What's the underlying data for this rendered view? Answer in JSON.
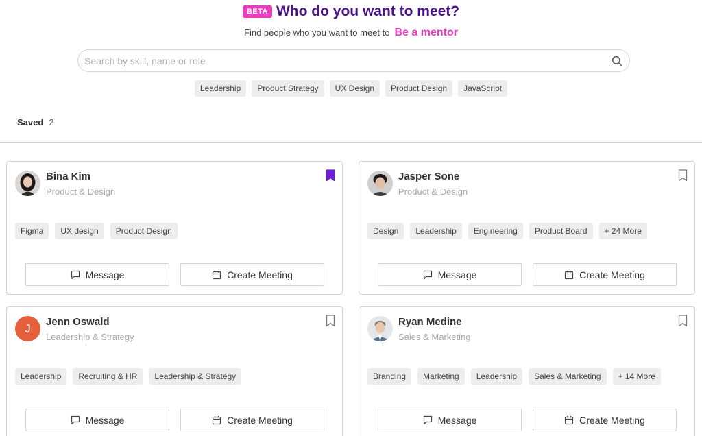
{
  "header": {
    "badge": "BETA",
    "title": "Who do you want to meet?",
    "subtitle": "Find people who you want to meet to",
    "mentor_link": "Be a mentor"
  },
  "search": {
    "placeholder": "Search by skill, name or role",
    "value": ""
  },
  "filter_chips": [
    "Leadership",
    "Product Strategy",
    "UX Design",
    "Product Design",
    "JavaScript"
  ],
  "saved": {
    "label": "Saved",
    "count": "2"
  },
  "actions": {
    "message": "Message",
    "create_meeting": "Create Meeting"
  },
  "people": [
    {
      "name": "Bina Kim",
      "role": "Product & Design",
      "skills": [
        "Figma",
        "UX design",
        "Product Design"
      ],
      "bookmarked": true,
      "avatar_initial": ""
    },
    {
      "name": "Jasper Sone",
      "role": "Product & Design",
      "skills": [
        "Design",
        "Leadership",
        "Engineering",
        "Product Board",
        "+ 24 More"
      ],
      "bookmarked": false,
      "avatar_initial": ""
    },
    {
      "name": "Jenn Oswald",
      "role": "Leadership & Strategy",
      "skills": [
        "Leadership",
        "Recruiting & HR",
        "Leadership & Strategy"
      ],
      "bookmarked": false,
      "avatar_initial": "J"
    },
    {
      "name": "Ryan Medine",
      "role": "Sales & Marketing",
      "skills": [
        "Branding",
        "Marketing",
        "Leadership",
        "Sales & Marketing",
        "+ 14 More"
      ],
      "bookmarked": false,
      "avatar_initial": ""
    }
  ],
  "colors": {
    "brand_purple": "#4b148c",
    "accent_pink": "#e83fbf",
    "bookmark_active": "#6b1fd6",
    "avatar_orange": "#e5603a"
  },
  "icons": {
    "search": "search-icon",
    "bookmark": "bookmark-icon",
    "message": "chat-bubble-icon",
    "meeting": "calendar-icon"
  }
}
